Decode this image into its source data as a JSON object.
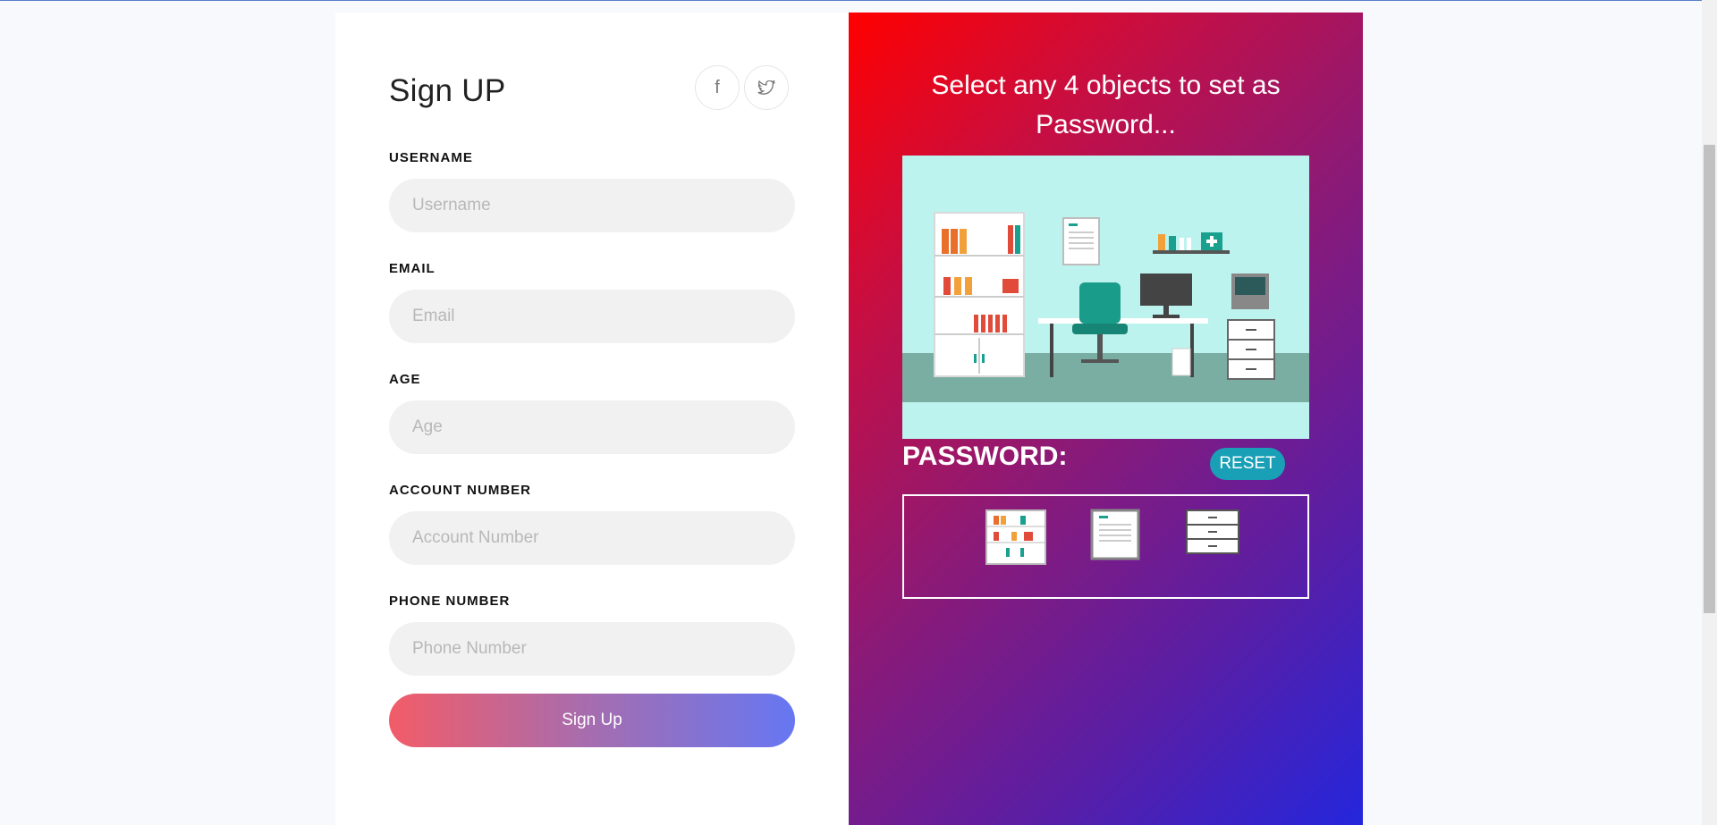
{
  "signup": {
    "title": "Sign UP",
    "social": [
      {
        "icon": "facebook-icon",
        "glyph": "f"
      },
      {
        "icon": "twitter-icon"
      }
    ],
    "fields": [
      {
        "label": "USERNAME",
        "placeholder": "Username",
        "value": ""
      },
      {
        "label": "EMAIL",
        "placeholder": "Email",
        "value": ""
      },
      {
        "label": "AGE",
        "placeholder": "Age",
        "value": ""
      },
      {
        "label": "ACCOUNT NUMBER",
        "placeholder": "Account Number",
        "value": ""
      },
      {
        "label": "PHONE NUMBER",
        "placeholder": "Phone Number",
        "value": ""
      }
    ],
    "submit_label": "Sign Up"
  },
  "password_panel": {
    "heading": "Select any 4 objects to set as Password...",
    "scene_icon": "doctor-office-illustration",
    "password_label": "PASSWORD:",
    "reset_label": "RESET",
    "selected": [
      {
        "icon": "medicine-cabinet-icon"
      },
      {
        "icon": "clipboard-icon"
      },
      {
        "icon": "drawer-cabinet-icon"
      }
    ]
  },
  "colors": {
    "gradient_start": "#ff0000",
    "gradient_end": "#2426dc",
    "reset_button": "#1aa0b6",
    "signup_gradient_start": "#f25c68",
    "signup_gradient_end": "#6677f2"
  }
}
